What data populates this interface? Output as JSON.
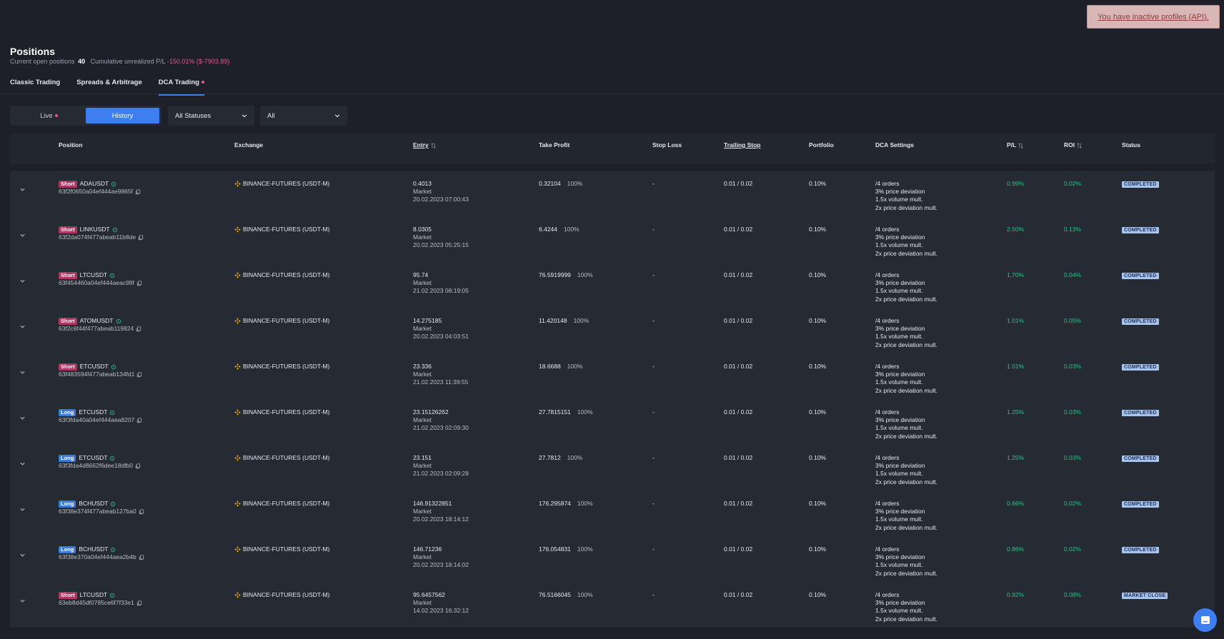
{
  "alert": {
    "text": "You have inactive profiles (API)."
  },
  "page": {
    "title": "Positions",
    "open_label": "Current open positions",
    "open_count": "40",
    "pl_label": "Cumulative unrealized P/L",
    "pl_value": "-150.01% ($-7903.89)"
  },
  "tabs": [
    {
      "label": "Classic Trading"
    },
    {
      "label": "Spreads & Arbitrage"
    },
    {
      "label": "DCA Trading"
    }
  ],
  "filters": {
    "live_label": "Live",
    "history_label": "History",
    "status_select": "All Statuses",
    "all_select": "All"
  },
  "columns": {
    "position": "Position",
    "exchange": "Exchange",
    "entry": "Entry",
    "take_profit": "Take Profit",
    "stop_loss": "Stop Loss",
    "trailing_stop": "Trailing Stop",
    "portfolio": "Portfolio",
    "dca_settings": "DCA Settings",
    "pl": "P/L",
    "roi": "ROI",
    "status": "Status"
  },
  "rows": [
    {
      "side": "Short",
      "symbol": "ADAUSDT",
      "id": "63f2f0650a04ef444ae9865f",
      "exchange": "BINANCE-FUTURES (USDT-M)",
      "entry_price": "0.4013",
      "entry_type": "Market",
      "entry_date": "20.02.2023 07:00:43",
      "tp_price": "0.32104",
      "tp_pct": "100%",
      "stop_loss": "-",
      "trailing": "0.01 / 0.02",
      "portfolio": "0.10%",
      "dca_orders": "/4 orders",
      "dca_dev": "3% price deviation",
      "dca_vol": "1.5x volume mult.",
      "dca_devmult": "2x price deviation mult.",
      "pl": "0.99%",
      "roi": "0.02%",
      "status": "COMPLETED"
    },
    {
      "side": "Short",
      "symbol": "LINKUSDT",
      "id": "63f2da074f477abeab11b8de",
      "exchange": "BINANCE-FUTURES (USDT-M)",
      "entry_price": "8.0305",
      "entry_type": "Market",
      "entry_date": "20.02.2023 05:25:15",
      "tp_price": "6.4244",
      "tp_pct": "100%",
      "stop_loss": "-",
      "trailing": "0.01 / 0.02",
      "portfolio": "0.10%",
      "dca_orders": "/4 orders",
      "dca_dev": "3% price deviation",
      "dca_vol": "1.5x volume mult.",
      "dca_devmult": "2x price deviation mult.",
      "pl": "2.50%",
      "roi": "0.13%",
      "status": "COMPLETED"
    },
    {
      "side": "Short",
      "symbol": "LTCUSDT",
      "id": "63f454460a04ef444aeac99f",
      "exchange": "BINANCE-FUTURES (USDT-M)",
      "entry_price": "95.74",
      "entry_type": "Market",
      "entry_date": "21.02.2023 08:19:05",
      "tp_price": "76.5919999",
      "tp_pct": "100%",
      "stop_loss": "-",
      "trailing": "0.01 / 0.02",
      "portfolio": "0.10%",
      "dca_orders": "/4 orders",
      "dca_dev": "3% price deviation",
      "dca_vol": "1.5x volume mult.",
      "dca_devmult": "2x price deviation mult.",
      "pl": "1.70%",
      "roi": "0.04%",
      "status": "COMPLETED"
    },
    {
      "side": "Short",
      "symbol": "ATOMUSDT",
      "id": "63f2c6f44f477abeab119824",
      "exchange": "BINANCE-FUTURES (USDT-M)",
      "entry_price": "14.275185",
      "entry_type": "Market",
      "entry_date": "20.02.2023 04:03:51",
      "tp_price": "11.420148",
      "tp_pct": "100%",
      "stop_loss": "-",
      "trailing": "0.01 / 0.02",
      "portfolio": "0.10%",
      "dca_orders": "/4 orders",
      "dca_dev": "3% price deviation",
      "dca_vol": "1.5x volume mult.",
      "dca_devmult": "2x price deviation mult.",
      "pl": "1.01%",
      "roi": "0.05%",
      "status": "COMPLETED"
    },
    {
      "side": "Short",
      "symbol": "ETCUSDT",
      "id": "63f483594f477abeab134fd1",
      "exchange": "BINANCE-FUTURES (USDT-M)",
      "entry_price": "23.336",
      "entry_type": "Market",
      "entry_date": "21.02.2023 11:39:55",
      "tp_price": "18.6688",
      "tp_pct": "100%",
      "stop_loss": "-",
      "trailing": "0.01 / 0.02",
      "portfolio": "0.10%",
      "dca_orders": "/4 orders",
      "dca_dev": "3% price deviation",
      "dca_vol": "1.5x volume mult.",
      "dca_devmult": "2x price deviation mult.",
      "pl": "1.01%",
      "roi": "0.03%",
      "status": "COMPLETED"
    },
    {
      "side": "Long",
      "symbol": "ETCUSDT",
      "id": "63f3fda40a04ef444aea8207",
      "exchange": "BINANCE-FUTURES (USDT-M)",
      "entry_price": "23.15126262",
      "entry_type": "Market",
      "entry_date": "21.02.2023 02:09:30",
      "tp_price": "27.7815151",
      "tp_pct": "100%",
      "stop_loss": "-",
      "trailing": "0.01 / 0.02",
      "portfolio": "0.10%",
      "dca_orders": "/4 orders",
      "dca_dev": "3% price deviation",
      "dca_vol": "1.5x volume mult.",
      "dca_devmult": "2x price deviation mult.",
      "pl": "1.25%",
      "roi": "0.03%",
      "status": "COMPLETED"
    },
    {
      "side": "Long",
      "symbol": "ETCUSDT",
      "id": "63f3fda4d8662f6dee18dfb0",
      "exchange": "BINANCE-FUTURES (USDT-M)",
      "entry_price": "23.151",
      "entry_type": "Market",
      "entry_date": "21.02.2023 02:09:28",
      "tp_price": "27.7812",
      "tp_pct": "100%",
      "stop_loss": "-",
      "trailing": "0.01 / 0.02",
      "portfolio": "0.10%",
      "dca_orders": "/4 orders",
      "dca_dev": "3% price deviation",
      "dca_vol": "1.5x volume mult.",
      "dca_devmult": "2x price deviation mult.",
      "pl": "1.25%",
      "roi": "0.03%",
      "status": "COMPLETED"
    },
    {
      "side": "Long",
      "symbol": "BCHUSDT",
      "id": "63f38e374f477abeab127ba0",
      "exchange": "BINANCE-FUTURES (USDT-M)",
      "entry_price": "146.91322851",
      "entry_type": "Market",
      "entry_date": "20.02.2023 18:14:12",
      "tp_price": "176.295874",
      "tp_pct": "100%",
      "stop_loss": "-",
      "trailing": "0.01 / 0.02",
      "portfolio": "0.10%",
      "dca_orders": "/4 orders",
      "dca_dev": "3% price deviation",
      "dca_vol": "1.5x volume mult.",
      "dca_devmult": "2x price deviation mult.",
      "pl": "0.66%",
      "roi": "0.02%",
      "status": "COMPLETED"
    },
    {
      "side": "Long",
      "symbol": "BCHUSDT",
      "id": "63f38e370a04ef444aea2b4b",
      "exchange": "BINANCE-FUTURES (USDT-M)",
      "entry_price": "146.71236",
      "entry_type": "Market",
      "entry_date": "20.02.2023 18:14:02",
      "tp_price": "176.054831",
      "tp_pct": "100%",
      "stop_loss": "-",
      "trailing": "0.01 / 0.02",
      "portfolio": "0.10%",
      "dca_orders": "/4 orders",
      "dca_dev": "3% price deviation",
      "dca_vol": "1.5x volume mult.",
      "dca_devmult": "2x price deviation mult.",
      "pl": "0.86%",
      "roi": "0.02%",
      "status": "COMPLETED"
    },
    {
      "side": "Short",
      "symbol": "LTCUSDT",
      "id": "63eb8d45df0785ce6f7f33e1",
      "exchange": "BINANCE-FUTURES (USDT-M)",
      "entry_price": "95.6457562",
      "entry_type": "Market",
      "entry_date": "14.02.2023 16:32:12",
      "tp_price": "76.5166045",
      "tp_pct": "100%",
      "stop_loss": "-",
      "trailing": "0.01 / 0.02",
      "portfolio": "0.10%",
      "dca_orders": "/4 orders",
      "dca_dev": "3% price deviation",
      "dca_vol": "1.5x volume mult.",
      "dca_devmult": "2x price deviation mult.",
      "pl": "0.92%",
      "roi": "0.08%",
      "status": "MARKET CLOSE"
    }
  ]
}
